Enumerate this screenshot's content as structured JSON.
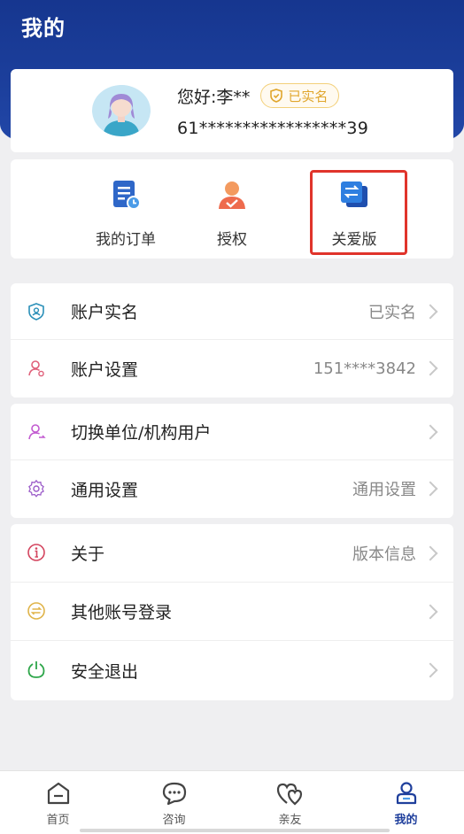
{
  "header": {
    "title": "我的"
  },
  "profile": {
    "greeting": "您好:李**",
    "badge": "已实名",
    "id_number": "61*****************39"
  },
  "shortcuts": [
    {
      "label": "我的订单",
      "icon": "order-icon"
    },
    {
      "label": "授权",
      "icon": "authorize-icon"
    },
    {
      "label": "关爱版",
      "icon": "care-version-icon"
    }
  ],
  "menu": {
    "account_realname": {
      "label": "账户实名",
      "value": "已实名"
    },
    "account_settings": {
      "label": "账户设置",
      "value": "151****3842"
    },
    "switch_user": {
      "label": "切换单位/机构用户",
      "value": ""
    },
    "general_settings": {
      "label": "通用设置",
      "value": "通用设置"
    },
    "about": {
      "label": "关于",
      "value": "版本信息"
    },
    "other_login": {
      "label": "其他账号登录",
      "value": ""
    },
    "logout": {
      "label": "安全退出",
      "value": ""
    }
  },
  "tabs": [
    {
      "label": "首页",
      "icon": "home-icon"
    },
    {
      "label": "咨询",
      "icon": "chat-icon"
    },
    {
      "label": "亲友",
      "icon": "family-icon"
    },
    {
      "label": "我的",
      "icon": "profile-icon",
      "active": true
    }
  ],
  "colors": {
    "header_blue": "#1c3f9c",
    "badge_gold": "#e0a62d",
    "highlight_red": "#e0342b"
  }
}
